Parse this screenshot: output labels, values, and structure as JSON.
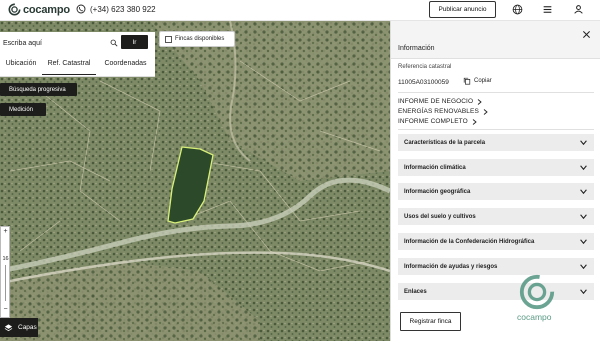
{
  "header": {
    "brand": "cocampo",
    "phone": "(+34) 623 380 922",
    "publish_label": "Publicar anuncio",
    "icons": [
      "globe-icon",
      "menu-icon",
      "user-icon"
    ]
  },
  "search": {
    "placeholder": "Escriba aquí",
    "go_label": "Ir",
    "tabs": [
      {
        "label": "Ubicación",
        "active": false
      },
      {
        "label": "Ref. Catastral",
        "active": true
      },
      {
        "label": "Coordenadas",
        "active": false
      }
    ]
  },
  "map": {
    "fincas_label": "Fincas disponibles",
    "progressive_label": "Búsqueda progresiva",
    "measure_label": "Medición",
    "zoom": {
      "plus": "+",
      "level": "16",
      "minus": "−"
    },
    "layers_label": "Capas"
  },
  "panel": {
    "title": "Información",
    "ref_label": "Referencia catastral",
    "ref_value": "11005A03100059",
    "copy_label": "Copiar",
    "reports": [
      "INFORME DE NEGOCIO",
      "ENERGÍAS RENOVABLES",
      "INFORME COMPLETO"
    ],
    "sections": [
      "Características de la parcela",
      "Información climática",
      "Información geográfica",
      "Usos del suelo y cultivos",
      "Información de la Confederación Hidrográfica",
      "Información de ayudas y riesgos",
      "Enlaces"
    ],
    "register_label": "Registrar finca",
    "watermark": "cocampo"
  },
  "colors": {
    "brand": "#4b8f7a",
    "dark_button": "#1d1d1b",
    "parcel_outline": "#d8f07a"
  }
}
